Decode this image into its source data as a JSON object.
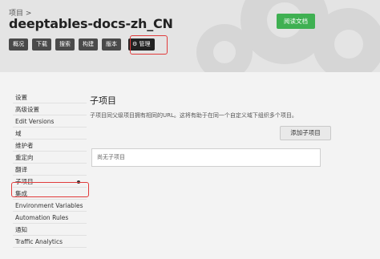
{
  "header": {
    "breadcrumb": "项目 >",
    "project_title": "deeptables-docs-zh_CN",
    "read_docs_label": "阅读文档",
    "nav_buttons": [
      "概况",
      "下载",
      "搜索",
      "构建",
      "版本"
    ],
    "admin_label": "⚙ 管理"
  },
  "sidebar": {
    "items": [
      "设置",
      "高级设置",
      "Edit Versions",
      "域",
      "维护者",
      "重定向",
      "翻译",
      "子项目",
      "集成",
      "Environment Variables",
      "Automation Rules",
      "通知",
      "Traffic Analytics"
    ]
  },
  "main": {
    "title": "子项目",
    "description": "子项目同父级项目拥有相同的URL。这将有助于在同一个自定义域下组织多个项目。",
    "add_button_label": "添加子项目",
    "empty_text": "尚无子项目"
  },
  "colors": {
    "accent_green": "#3fb052",
    "highlight_red": "#e03b3b",
    "nav_dark": "#4a4a4a"
  }
}
